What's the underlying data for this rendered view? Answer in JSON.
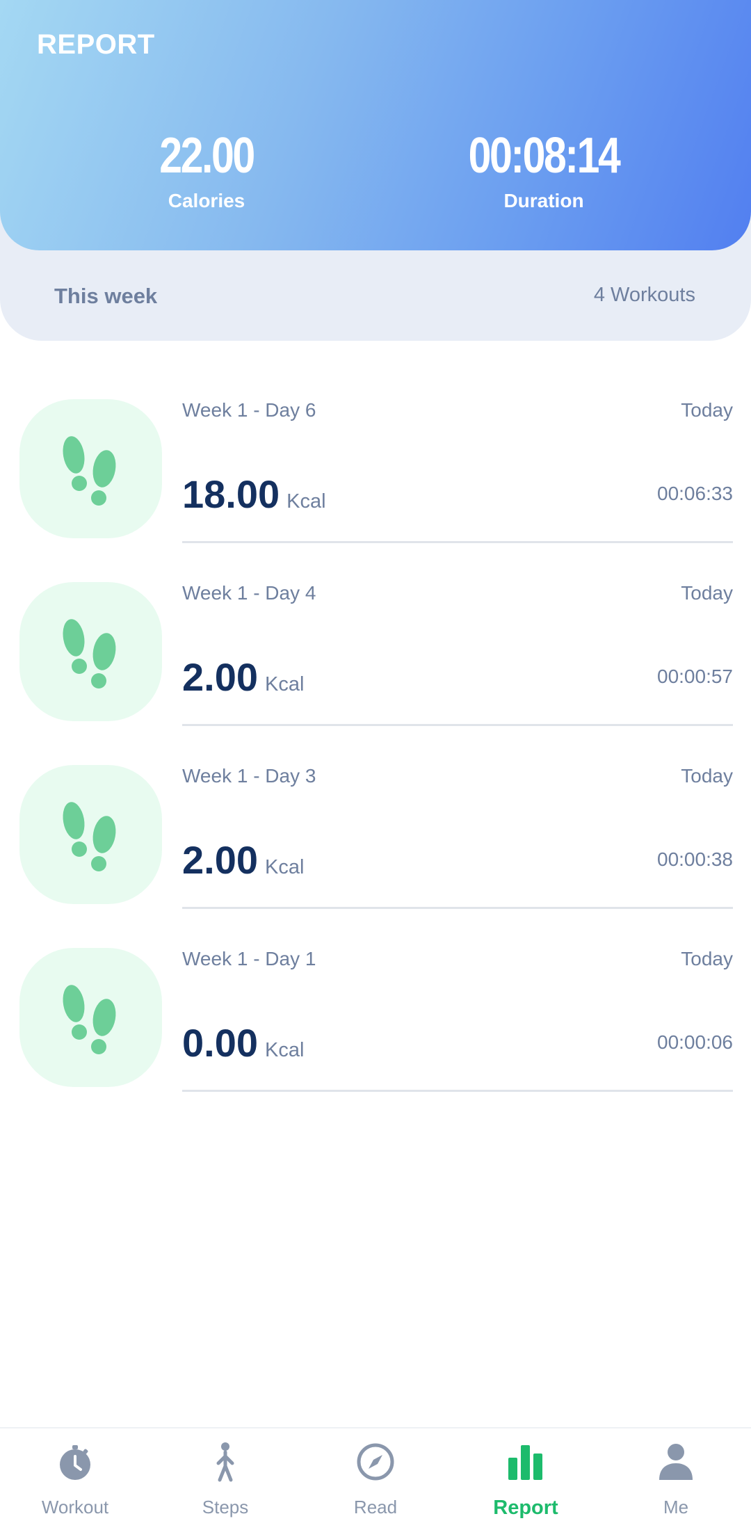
{
  "header": {
    "title": "REPORT",
    "calories_value": "22.00",
    "calories_label": "Calories",
    "duration_value": "00:08:14",
    "duration_label": "Duration"
  },
  "week": {
    "label": "This week",
    "count": "4 Workouts"
  },
  "workouts": [
    {
      "title": "Week 1 - Day 6",
      "date": "Today",
      "kcal": "18.00",
      "unit": "Kcal",
      "time": "00:06:33",
      "icon": "footsteps-icon"
    },
    {
      "title": "Week 1 - Day 4",
      "date": "Today",
      "kcal": "2.00",
      "unit": "Kcal",
      "time": "00:00:57",
      "icon": "footsteps-icon"
    },
    {
      "title": "Week 1 - Day 3",
      "date": "Today",
      "kcal": "2.00",
      "unit": "Kcal",
      "time": "00:00:38",
      "icon": "footsteps-icon"
    },
    {
      "title": "Week 1 - Day 1",
      "date": "Today",
      "kcal": "0.00",
      "unit": "Kcal",
      "time": "00:00:06",
      "icon": "footsteps-icon"
    }
  ],
  "tabs": [
    {
      "label": "Workout",
      "icon": "stopwatch-icon",
      "active": false
    },
    {
      "label": "Steps",
      "icon": "walking-person-icon",
      "active": false
    },
    {
      "label": "Read",
      "icon": "compass-icon",
      "active": false
    },
    {
      "label": "Report",
      "icon": "bar-chart-icon",
      "active": true
    },
    {
      "label": "Me",
      "icon": "person-icon",
      "active": false
    }
  ],
  "colors": {
    "accent_green": "#1dbb6c",
    "header_gradient_start": "#a4d8f3",
    "header_gradient_end": "#527ff0",
    "kcal_text": "#14305f",
    "muted_text": "#6e7f9e"
  }
}
